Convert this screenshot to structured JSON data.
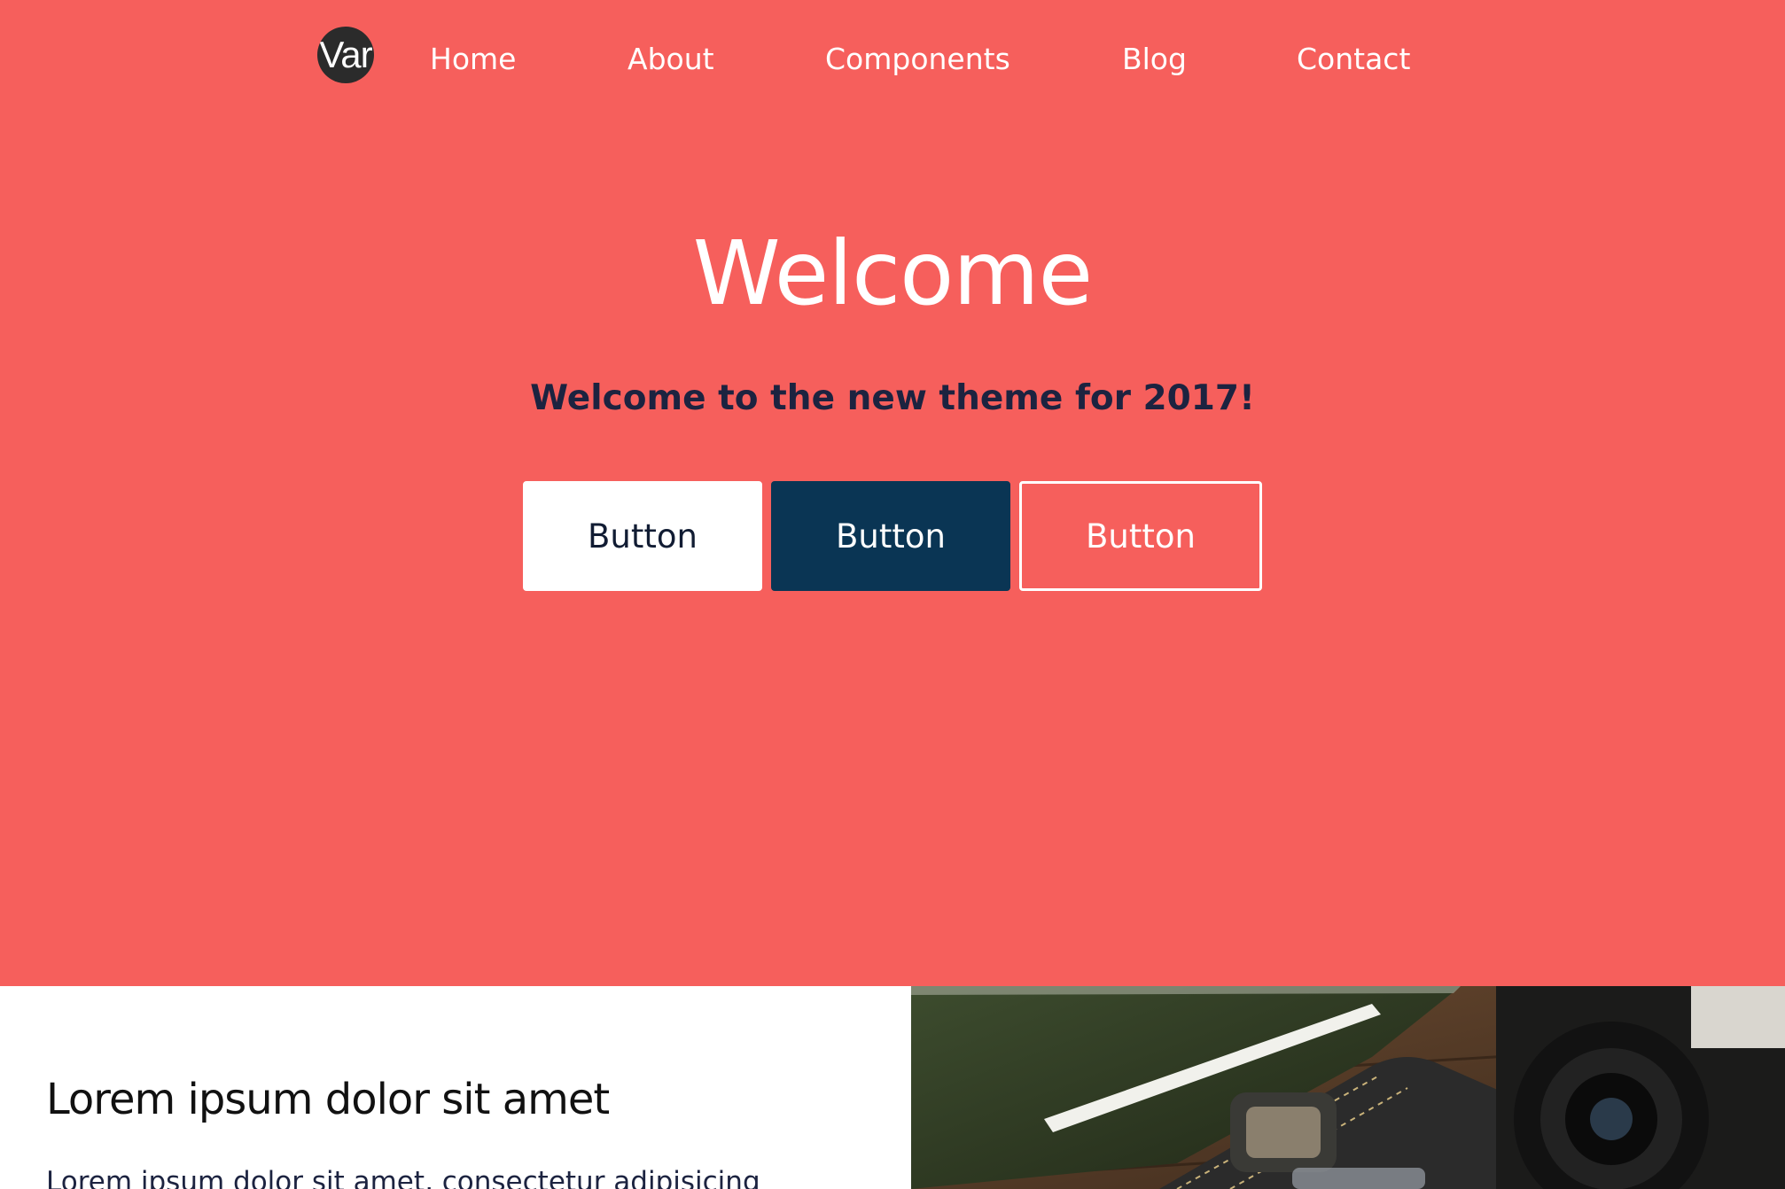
{
  "brand": {
    "logo_text": "Var"
  },
  "nav": {
    "items": [
      {
        "label": "Home"
      },
      {
        "label": "About"
      },
      {
        "label": "Components"
      },
      {
        "label": "Blog"
      },
      {
        "label": "Contact"
      }
    ]
  },
  "hero": {
    "title": "Welcome",
    "subtitle": "Welcome to the new theme for 2017!",
    "buttons": [
      {
        "label": "Button"
      },
      {
        "label": "Button"
      },
      {
        "label": "Button"
      }
    ],
    "background_color": "#f65f5c"
  },
  "feature": {
    "heading": "Lorem ipsum dolor sit amet",
    "text": "Lorem ipsum dolor sit amet, consectetur adipisicing",
    "image_icon": "desk-photo"
  },
  "colors": {
    "accent": "#f65f5c",
    "dark_button": "#0a3554",
    "subtitle_text": "#1c2340"
  }
}
